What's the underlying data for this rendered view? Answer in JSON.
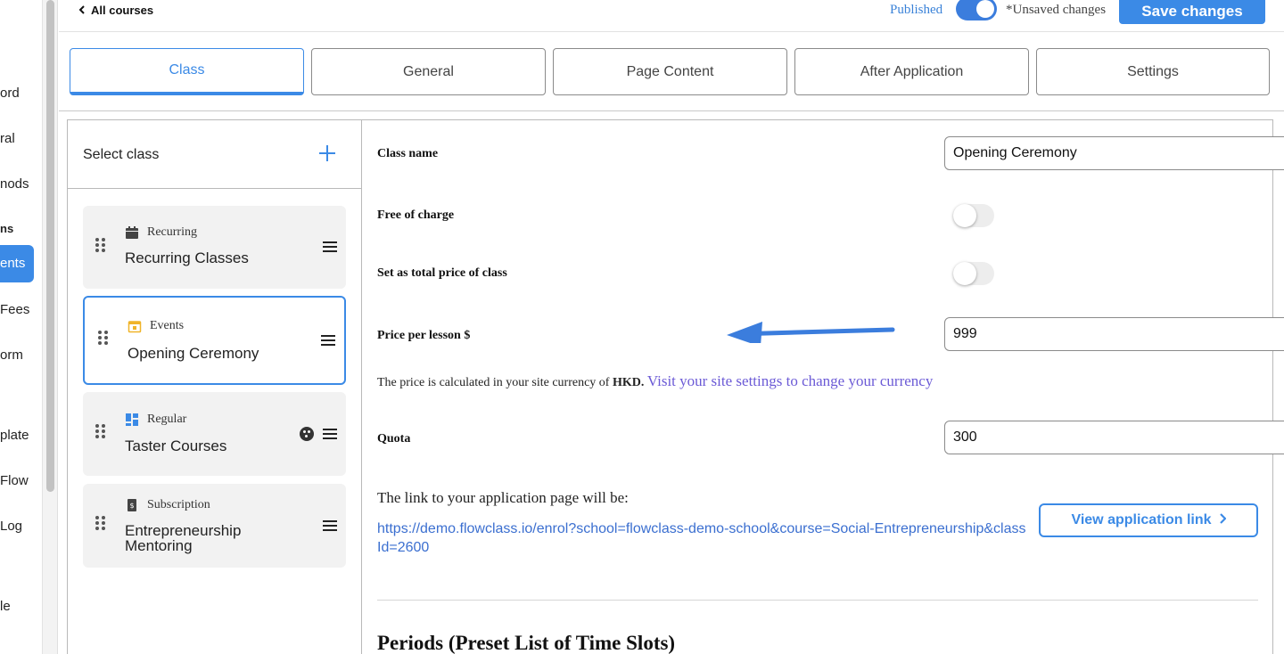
{
  "sidebar": {
    "items": [
      {
        "label": "ord"
      },
      {
        "label": "ral"
      },
      {
        "label": "nods"
      },
      {
        "label": "ns"
      },
      {
        "label": "ents"
      },
      {
        "label": "Fees"
      },
      {
        "label": "orm"
      },
      {
        "label": "plate"
      },
      {
        "label": "Flow"
      },
      {
        "label": "Log"
      },
      {
        "label": "le"
      }
    ],
    "active_index": 4
  },
  "topbar": {
    "back_label": "All courses",
    "published_label": "Published",
    "published_on": true,
    "unsaved_label": "*Unsaved changes",
    "save_label": "Save changes"
  },
  "tabs": [
    {
      "label": "Class",
      "active": true
    },
    {
      "label": "General",
      "active": false
    },
    {
      "label": "Page Content",
      "active": false
    },
    {
      "label": "After Application",
      "active": false
    },
    {
      "label": "Settings",
      "active": false
    }
  ],
  "class_list": {
    "title": "Select class",
    "items": [
      {
        "type": "Recurring",
        "name": "Recurring Classes",
        "icon": "calendar-icon",
        "selected": false
      },
      {
        "type": "Events",
        "name": "Opening Ceremony",
        "icon": "event-calendar-icon",
        "selected": true
      },
      {
        "type": "Regular",
        "name": "Taster Courses",
        "icon": "grid-icon",
        "selected": false
      },
      {
        "type": "Subscription",
        "name_line1": "Entrepreneurship",
        "name_line2": "Mentoring",
        "icon": "subscription-icon",
        "selected": false
      }
    ]
  },
  "form": {
    "class_name_label": "Class name",
    "class_name_value": "Opening Ceremony",
    "free_label": "Free of charge",
    "free_on": false,
    "total_price_label": "Set as total price of class",
    "total_price_on": false,
    "price_label": "Price per lesson $",
    "price_value": "999",
    "hint_prefix": "The price is calculated in your site currency of ",
    "hint_currency": "HKD.",
    "hint_link": "Visit your site settings to change your currency",
    "quota_label": "Quota",
    "quota_value": "300",
    "link_intro": "The link to your application page will be:",
    "application_url": "https://demo.flowclass.io/enrol?school=flowclass-demo-school&course=Social-Entrepreneurship&classId=2600",
    "view_link_label": "View application link",
    "periods_title": "Periods (Preset List of Time Slots)"
  },
  "colors": {
    "accent": "#3b8ae6",
    "link_purple": "#6b5ad6",
    "annotation_arrow": "#3b7ddd"
  }
}
